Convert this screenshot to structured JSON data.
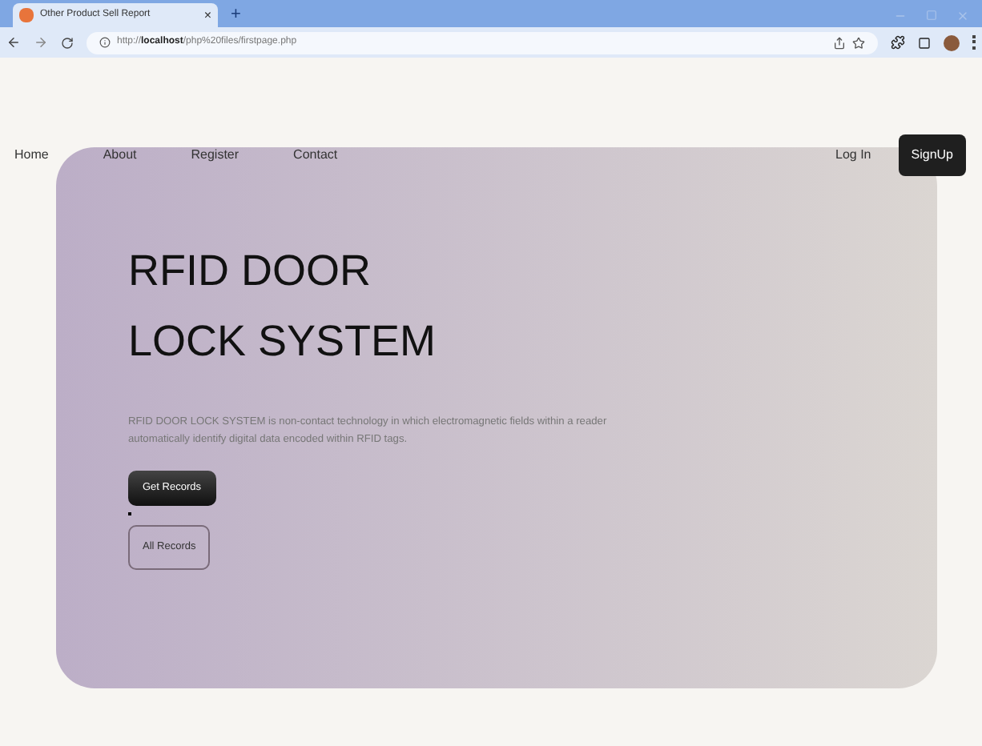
{
  "browser": {
    "tab_title": "Other Product Sell Report",
    "tab_close": "×",
    "new_tab": "+",
    "url_scheme": "http://",
    "url_host": "localhost",
    "url_path": "/php%20files/firstpage.php"
  },
  "nav": {
    "links": [
      "Home",
      "About",
      "Register",
      "Contact"
    ],
    "login": "Log In",
    "signup": "SignUp"
  },
  "hero": {
    "title_lines": [
      "RFID DOOR",
      "LOCK SYSTEM"
    ],
    "description": "RFID DOOR LOCK SYSTEM is non-contact technology in which electromagnetic fields within a reader automatically identify digital data encoded within RFID tags.",
    "buttons": [
      {
        "label": "Get Records",
        "kind": "filled"
      },
      {
        "label": "All Records",
        "kind": "outline"
      }
    ]
  }
}
